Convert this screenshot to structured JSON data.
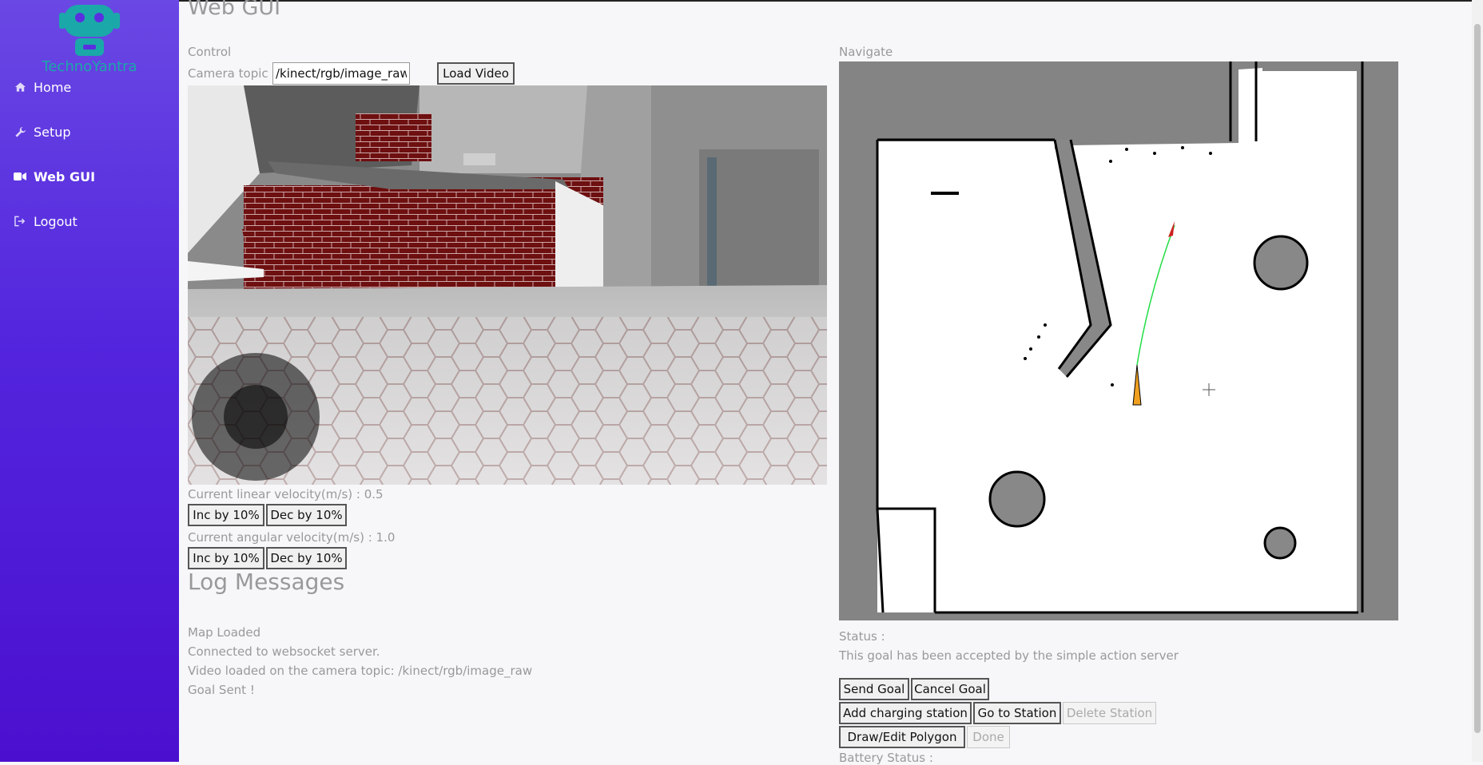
{
  "brand": {
    "name": "TechnoYantra"
  },
  "sidebar": {
    "items": [
      {
        "label": "Home",
        "icon": "home-icon"
      },
      {
        "label": "Setup",
        "icon": "wrench-icon"
      },
      {
        "label": "Web GUI",
        "icon": "video-camera-icon",
        "active": true
      },
      {
        "label": "Logout",
        "icon": "sign-out-icon"
      }
    ]
  },
  "page": {
    "title": "Web GUI"
  },
  "control": {
    "heading": "Control",
    "camera_label": "Camera topic :",
    "camera_value": "/kinect/rgb/image_raw",
    "load_video": "Load Video",
    "linear_label": "Current linear velocity(m/s) : 0.5",
    "angular_label": "Current angular velocity(m/s) : 1.0",
    "inc": "Inc by 10%",
    "dec": "Dec by 10%"
  },
  "log": {
    "title": "Log Messages",
    "messages": [
      "Map Loaded",
      "Connected to websocket server.",
      "Video loaded on the camera topic: /kinect/rgb/image_raw",
      "Goal Sent !"
    ]
  },
  "navigate": {
    "heading": "Navigate",
    "status_label": "Status :",
    "status_text": "This goal has been accepted by the simple action server",
    "send_goal": "Send Goal",
    "cancel_goal": "Cancel Goal",
    "add_station": "Add charging station",
    "go_station": "Go to Station",
    "delete_station": "Delete Station",
    "draw_polygon": "Draw/Edit Polygon",
    "done": "Done",
    "battery_label": "Battery Status :"
  },
  "colors": {
    "sidebar_top": "#6a48e4",
    "sidebar_bottom": "#4b10cf",
    "brand": "#1ba8a8",
    "path": "#22dd44",
    "robot": "#f0a020"
  }
}
